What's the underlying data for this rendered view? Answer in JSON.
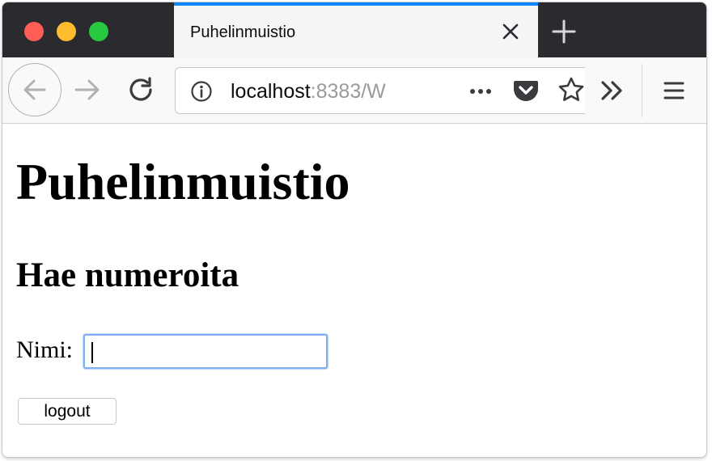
{
  "browser": {
    "tab": {
      "title": "Puhelinmuistio"
    },
    "url": {
      "host": "localhost",
      "rest": ":8383/W"
    },
    "colors": {
      "tab_accent": "#0a84ff",
      "close_red": "#fd5f57",
      "minimize_yellow": "#febc2e",
      "zoom_green": "#28c840"
    },
    "icons": {
      "close_tab": "close-icon",
      "new_tab": "plus-icon",
      "back": "arrow-left-icon",
      "forward": "arrow-right-icon",
      "reload": "reload-icon",
      "site_info": "info-icon",
      "page_actions": "ellipsis-icon",
      "pocket": "pocket-icon",
      "bookmark": "star-icon",
      "overflow": "double-chevron-right-icon",
      "menu": "hamburger-icon"
    }
  },
  "page": {
    "title": "Puhelinmuistio",
    "search": {
      "heading": "Hae numeroita",
      "name_label": "Nimi:",
      "name_value": ""
    },
    "logout_label": "logout"
  }
}
